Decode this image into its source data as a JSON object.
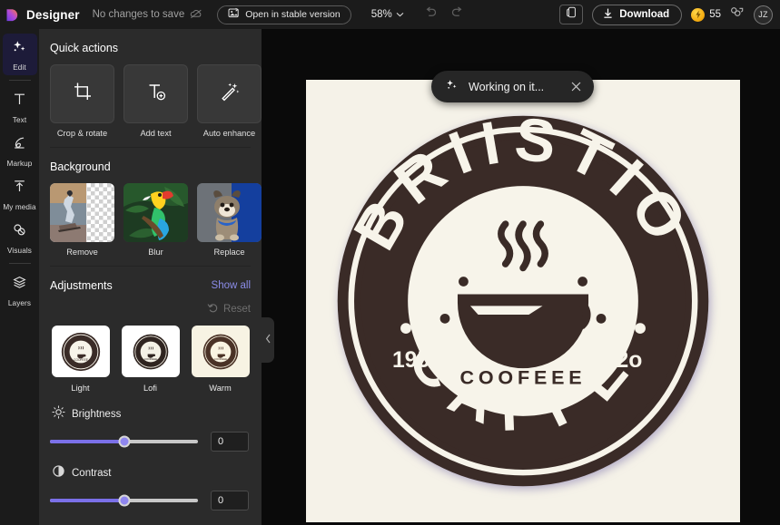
{
  "header": {
    "brand_name": "Designer",
    "save_state": "No changes to save",
    "cloud_off_icon": "cloud-off-icon",
    "stable_version_button": "Open in stable version",
    "stable_version_icon": "image-swap-icon",
    "zoom_level": "58%",
    "zoom_chevron_icon": "chevron-down-icon",
    "undo_icon": "undo-arrow-icon",
    "redo_icon": "redo-arrow-icon",
    "device_preview_icon": "device-preview-icon",
    "download_label": "Download",
    "download_icon": "download-arrow-icon",
    "credits_count": "55",
    "credits_icon": "lightning-coin-icon",
    "share_icon": "share-collaborate-icon",
    "avatar_initials": "JZ"
  },
  "rail": {
    "items": [
      {
        "label": "Edit",
        "icon": "sparkles-icon",
        "active": true
      },
      {
        "label": "Text",
        "icon": "text-t-icon",
        "active": false
      },
      {
        "label": "Markup",
        "icon": "pen-markup-icon",
        "active": false
      },
      {
        "label": "My media",
        "icon": "upload-arrow-icon",
        "active": false
      },
      {
        "label": "Visuals",
        "icon": "visuals-shapes-icon",
        "active": false
      },
      {
        "label": "Layers",
        "icon": "layers-stack-icon",
        "active": false
      }
    ]
  },
  "panel": {
    "quick_actions": {
      "title": "Quick actions",
      "items": [
        {
          "label": "Crop & rotate",
          "icon": "crop-icon"
        },
        {
          "label": "Add text",
          "icon": "add-text-icon"
        },
        {
          "label": "Auto enhance",
          "icon": "magic-wand-icon"
        }
      ]
    },
    "background": {
      "title": "Background",
      "items": [
        {
          "label": "Remove",
          "icon": "remove-background-thumb"
        },
        {
          "label": "Blur",
          "icon": "blur-background-thumb"
        },
        {
          "label": "Replace",
          "icon": "replace-background-thumb"
        }
      ]
    },
    "adjustments": {
      "title": "Adjustments",
      "show_all_label": "Show all",
      "reset_label": "Reset",
      "reset_icon": "reset-arrow-icon",
      "presets": [
        {
          "label": "Light",
          "bg": "#ffffff"
        },
        {
          "label": "Lofi",
          "bg": "#ffffff"
        },
        {
          "label": "Warm",
          "bg": "#f7f3e3"
        }
      ],
      "sliders": [
        {
          "label": "Brightness",
          "icon": "brightness-sun-icon",
          "value": "0",
          "position_pct": 50
        },
        {
          "label": "Contrast",
          "icon": "contrast-circle-icon",
          "value": "0",
          "position_pct": 50
        }
      ]
    },
    "collapse_icon": "chevron-left-icon"
  },
  "canvas": {
    "toast": {
      "text": "Working on it...",
      "icon": "sparkles-icon",
      "close_icon": "close-x-icon"
    },
    "artboard": {
      "name": "coffee-logo-artboard",
      "background_color": "#f5f2e8",
      "logo": {
        "top_arc_text": "BRIISTIO",
        "bottom_arc_text": "CAFFE",
        "center_text": "COOFEEE",
        "left_number": "195",
        "right_number": "192o",
        "ink_color": "#3a2b27",
        "paper_color": "#f7f4ea"
      }
    }
  }
}
